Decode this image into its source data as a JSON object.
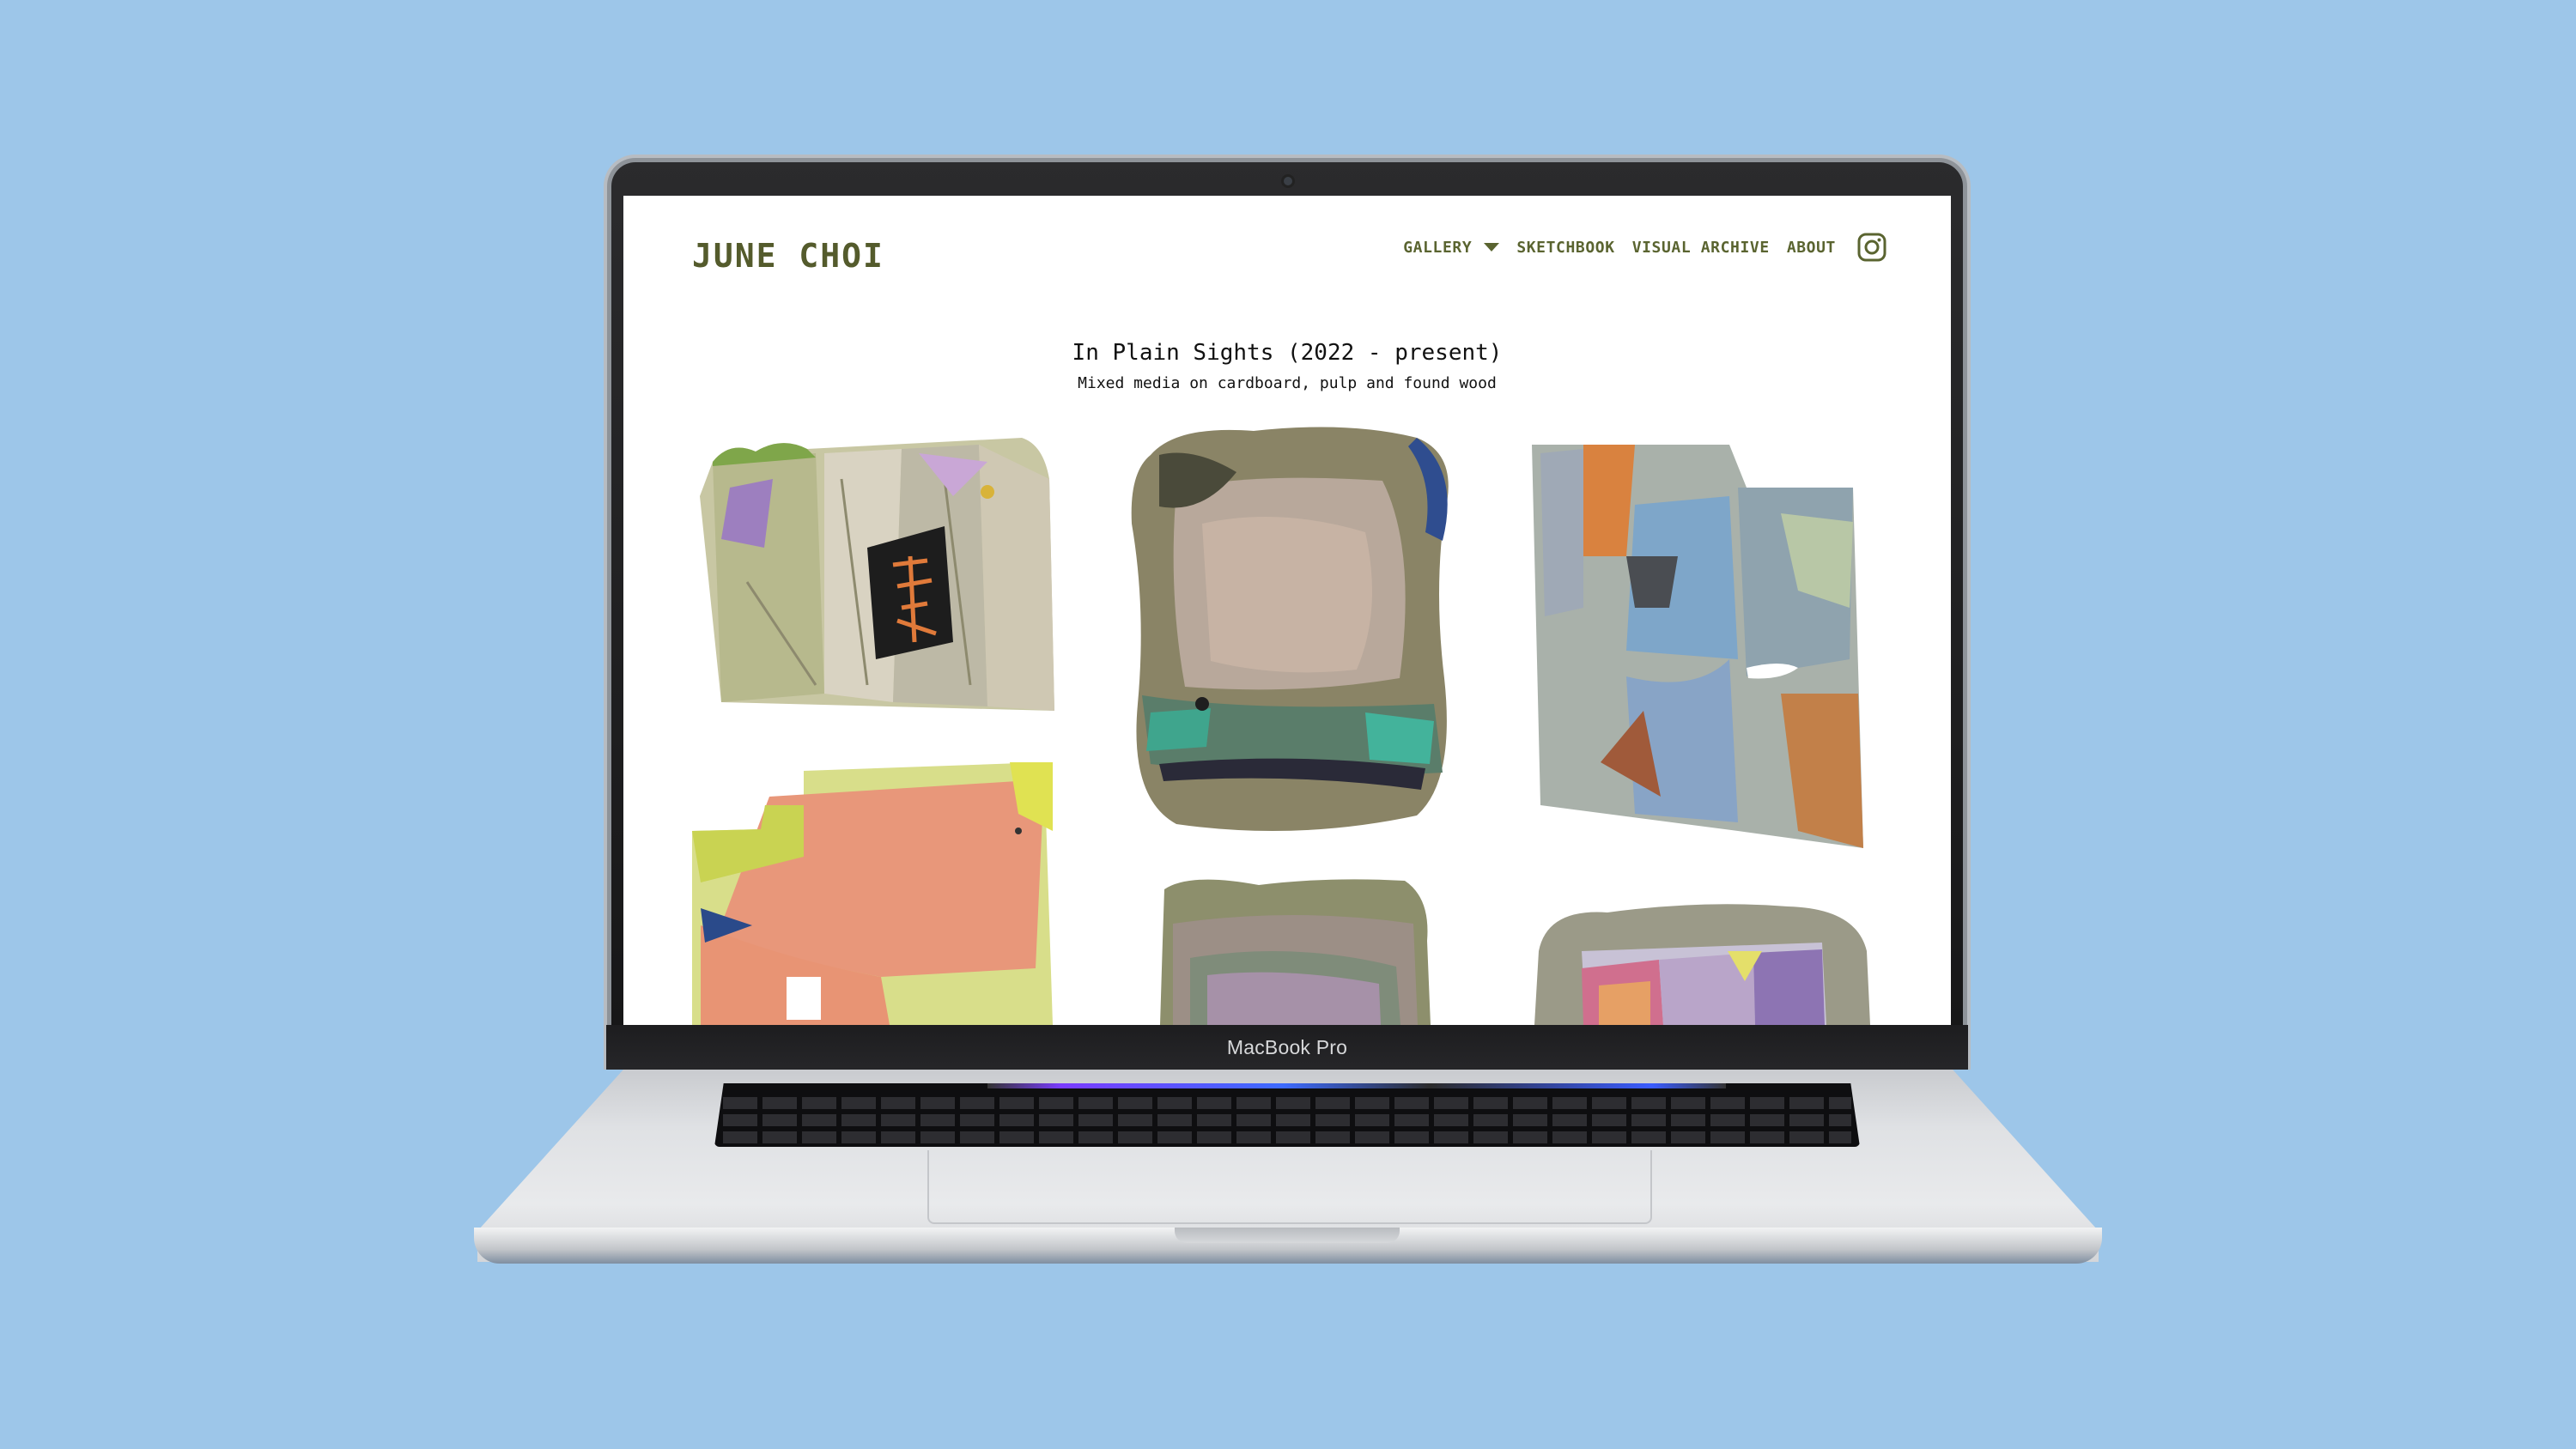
{
  "device": {
    "label": "MacBook Pro"
  },
  "site": {
    "title": "JUNE CHOI",
    "nav": [
      {
        "label": "GALLERY",
        "has_dropdown": true
      },
      {
        "label": "SKETCHBOOK"
      },
      {
        "label": "VISUAL ARCHIVE"
      },
      {
        "label": "ABOUT"
      }
    ],
    "social_icon": "instagram-icon"
  },
  "gallery": {
    "title": "In Plain Sights (2022 - present)",
    "subtitle": "Mixed media on cardboard, pulp and found wood"
  },
  "colors": {
    "background": "#9dc6e9",
    "nav_text": "#5a6430",
    "title_text": "#545b2c"
  }
}
